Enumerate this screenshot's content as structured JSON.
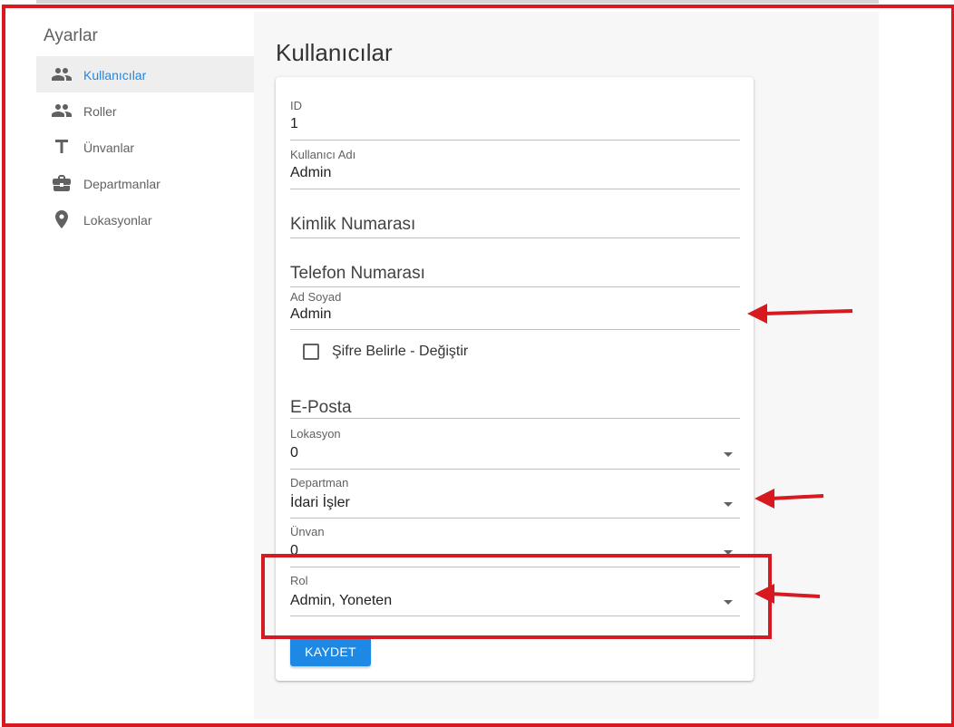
{
  "sidebar": {
    "title": "Ayarlar",
    "items": [
      {
        "label": "Kullanıcılar",
        "icon": "people-icon",
        "active": true
      },
      {
        "label": "Roller",
        "icon": "people-icon",
        "active": false
      },
      {
        "label": "Ünvanlar",
        "icon": "text-t-icon",
        "active": false
      },
      {
        "label": "Departmanlar",
        "icon": "briefcase-icon",
        "active": false
      },
      {
        "label": "Lokasyonlar",
        "icon": "location-pin-icon",
        "active": false
      }
    ]
  },
  "main": {
    "title": "Kullanıcılar",
    "form": {
      "id": {
        "label": "ID",
        "value": "1"
      },
      "username": {
        "label": "Kullanıcı Adı",
        "value": "Admin"
      },
      "identity_number": {
        "label": "Kimlik Numarası",
        "value": ""
      },
      "phone": {
        "label": "Telefon Numarası",
        "value": ""
      },
      "full_name": {
        "label": "Ad Soyad",
        "value": "Admin"
      },
      "password_checkbox": {
        "label": "Şifre Belirle - Değiştir",
        "checked": false
      },
      "email": {
        "label": "E-Posta",
        "value": ""
      },
      "location": {
        "label": "Lokasyon",
        "value": "0"
      },
      "department": {
        "label": "Departman",
        "value": "İdari İşler"
      },
      "title": {
        "label": "Ünvan",
        "value": "0"
      },
      "role": {
        "label": "Rol",
        "value": "Admin, Yoneten"
      },
      "save_label": "KAYDET"
    }
  },
  "colors": {
    "accent": "#1e88e5",
    "annotation": "#d71920"
  }
}
